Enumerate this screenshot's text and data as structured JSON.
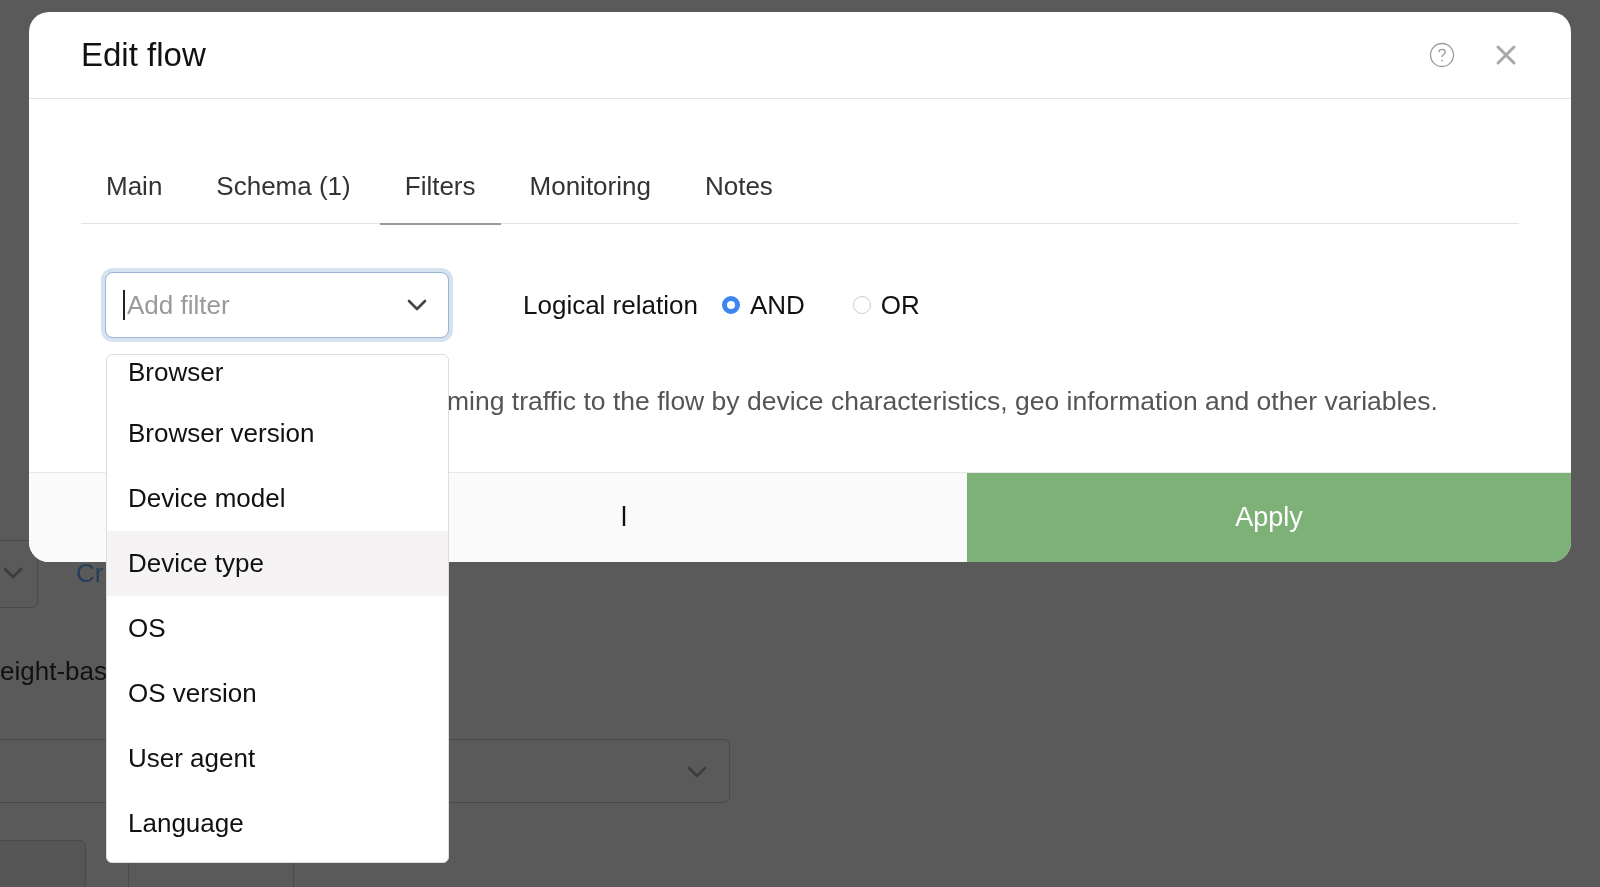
{
  "background": {
    "link": "Cr",
    "label": "eight-bas"
  },
  "dialog": {
    "title": "Edit flow",
    "tabs": [
      {
        "label": "Main",
        "selected": false
      },
      {
        "label": "Schema (1)",
        "selected": false
      },
      {
        "label": "Filters",
        "selected": true
      },
      {
        "label": "Monitoring",
        "selected": false
      },
      {
        "label": "Notes",
        "selected": false
      }
    ],
    "filter_select": {
      "placeholder": "Add filter",
      "expanded": true
    },
    "logical_relation": {
      "label": "Logical relation",
      "options": [
        {
          "label": "AND",
          "selected": true
        },
        {
          "label": "OR",
          "selected": false
        }
      ]
    },
    "description": "ming traffic to the flow by device characteristics, geo information and other variables.",
    "buttons": [
      {
        "label": "l",
        "kind": "secondary"
      },
      {
        "label": "Apply",
        "kind": "primary"
      }
    ]
  },
  "dropdown": {
    "items": [
      {
        "label": "Browser",
        "highlighted": false
      },
      {
        "label": "Browser version",
        "highlighted": false
      },
      {
        "label": "Device model",
        "highlighted": false
      },
      {
        "label": "Device type",
        "highlighted": true
      },
      {
        "label": "OS",
        "highlighted": false
      },
      {
        "label": "OS version",
        "highlighted": false
      },
      {
        "label": "User agent",
        "highlighted": false
      },
      {
        "label": "Language",
        "highlighted": false
      }
    ]
  }
}
